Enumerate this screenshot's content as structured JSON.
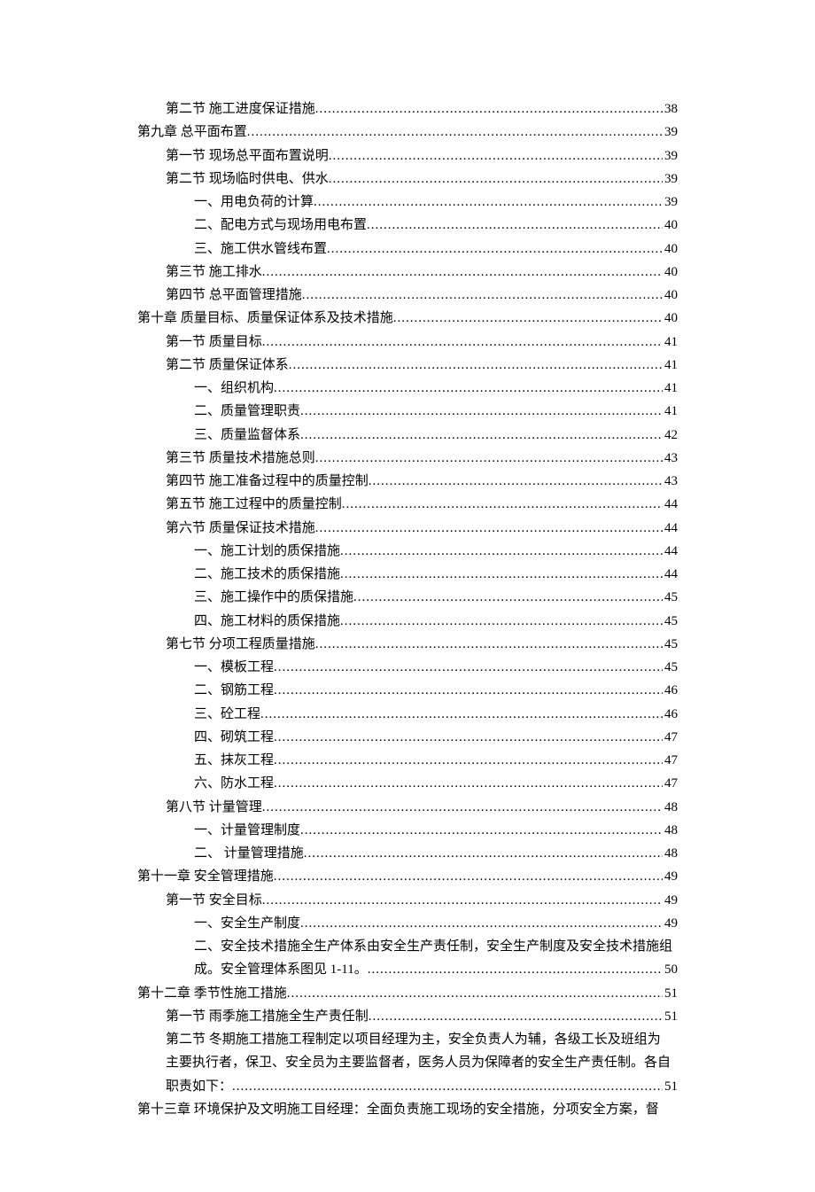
{
  "toc": [
    {
      "type": "dots",
      "indent": 1,
      "label": "第二节 施工进度保证措施",
      "page": "38"
    },
    {
      "type": "dots",
      "indent": 0,
      "label": "第九章 总平面布置",
      "page": "39"
    },
    {
      "type": "dots",
      "indent": 1,
      "label": "第一节 现场总平面布置说明",
      "page": "39"
    },
    {
      "type": "dots",
      "indent": 1,
      "label": "第二节 现场临时供电、供水",
      "page": "39"
    },
    {
      "type": "dots",
      "indent": 2,
      "label": "一、用电负荷的计算",
      "page": "39"
    },
    {
      "type": "dots",
      "indent": 2,
      "label": "二、配电方式与现场用电布置",
      "page": "40"
    },
    {
      "type": "dots",
      "indent": 2,
      "label": "三、施工供水管线布置",
      "page": "40"
    },
    {
      "type": "dots",
      "indent": 1,
      "label": "第三节 施工排水",
      "page": "40"
    },
    {
      "type": "dots",
      "indent": 1,
      "label": "第四节 总平面管理措施",
      "page": "40"
    },
    {
      "type": "dots",
      "indent": 0,
      "label": "第十章 质量目标、质量保证体系及技术措施",
      "page": "40"
    },
    {
      "type": "dots",
      "indent": 1,
      "label": "第一节 质量目标",
      "page": "41"
    },
    {
      "type": "dots",
      "indent": 1,
      "label": "第二节 质量保证体系",
      "page": "41"
    },
    {
      "type": "dots",
      "indent": 2,
      "label": "一、组织机构",
      "page": "41"
    },
    {
      "type": "dots",
      "indent": 2,
      "label": "二、质量管理职责",
      "page": "41"
    },
    {
      "type": "dots",
      "indent": 2,
      "label": "三、质量监督体系",
      "page": "42"
    },
    {
      "type": "dots",
      "indent": 1,
      "label": "第三节 质量技术措施总则",
      "page": "43"
    },
    {
      "type": "dots",
      "indent": 1,
      "label": "第四节 施工准备过程中的质量控制",
      "page": "43"
    },
    {
      "type": "dots",
      "indent": 1,
      "label": "第五节 施工过程中的质量控制",
      "page": "44"
    },
    {
      "type": "dots",
      "indent": 1,
      "label": "第六节 质量保证技术措施",
      "page": "44"
    },
    {
      "type": "dots",
      "indent": 2,
      "label": "一、施工计划的质保措施",
      "page": "44"
    },
    {
      "type": "dots",
      "indent": 2,
      "label": "二、施工技术的质保措施",
      "page": "44"
    },
    {
      "type": "dots",
      "indent": 2,
      "label": "三、施工操作中的质保措施",
      "page": "45"
    },
    {
      "type": "dots",
      "indent": 2,
      "label": "四、施工材料的质保措施",
      "page": "45"
    },
    {
      "type": "dots",
      "indent": 1,
      "label": "第七节 分项工程质量措施",
      "page": "45"
    },
    {
      "type": "dots",
      "indent": 2,
      "label": "一、模板工程",
      "page": "45"
    },
    {
      "type": "dots",
      "indent": 2,
      "label": "二、钢筋工程",
      "page": "46"
    },
    {
      "type": "dots",
      "indent": 2,
      "label": "三、砼工程",
      "page": "46"
    },
    {
      "type": "dots",
      "indent": 2,
      "label": "四、砌筑工程",
      "page": "47"
    },
    {
      "type": "dots",
      "indent": 2,
      "label": "五、抹灰工程",
      "page": "47"
    },
    {
      "type": "dots",
      "indent": 2,
      "label": "六、防水工程",
      "page": "47"
    },
    {
      "type": "dots",
      "indent": 1,
      "label": "第八节 计量管理",
      "page": "48"
    },
    {
      "type": "dots",
      "indent": 2,
      "label": "一、计量管理制度",
      "page": "48"
    },
    {
      "type": "dots",
      "indent": 2,
      "label": "二、 计量管理措施",
      "page": "48"
    },
    {
      "type": "dots",
      "indent": 0,
      "label": "第十一章 安全管理措施",
      "page": "49"
    },
    {
      "type": "dots",
      "indent": 1,
      "label": "第一节 安全目标",
      "page": "49"
    },
    {
      "type": "dots",
      "indent": 2,
      "label": "一、安全生产制度",
      "page": "49"
    },
    {
      "type": "wrap",
      "indent": 2,
      "lines": [
        "二、安全技术措施全生产体系由安全生产责任制，安全生产制度及安全技术措施组"
      ],
      "tail": "成。安全管理体系图见 1-11。 ",
      "page": "50"
    },
    {
      "type": "dots",
      "indent": 0,
      "label": "第十二章 季节性施工措施",
      "page": "51"
    },
    {
      "type": "dots",
      "indent": 1,
      "label": "第一节 雨季施工措施全生产责任制",
      "page": "51"
    },
    {
      "type": "wrap",
      "indent": 1,
      "lines": [
        "第二节 冬期施工措施工程制定以项目经理为主，安全负责人为辅，各级工长及班组为",
        "主要执行者，保卫、安全员为主要监督者，医务人员为保障者的安全生产责任制。各自"
      ],
      "tail": "职责如下：",
      "page": "51"
    },
    {
      "type": "plain",
      "indent": 0,
      "text": "第十三章 环境保护及文明施工目经理：全面负责施工现场的安全措施，分项安全方案，督"
    }
  ]
}
